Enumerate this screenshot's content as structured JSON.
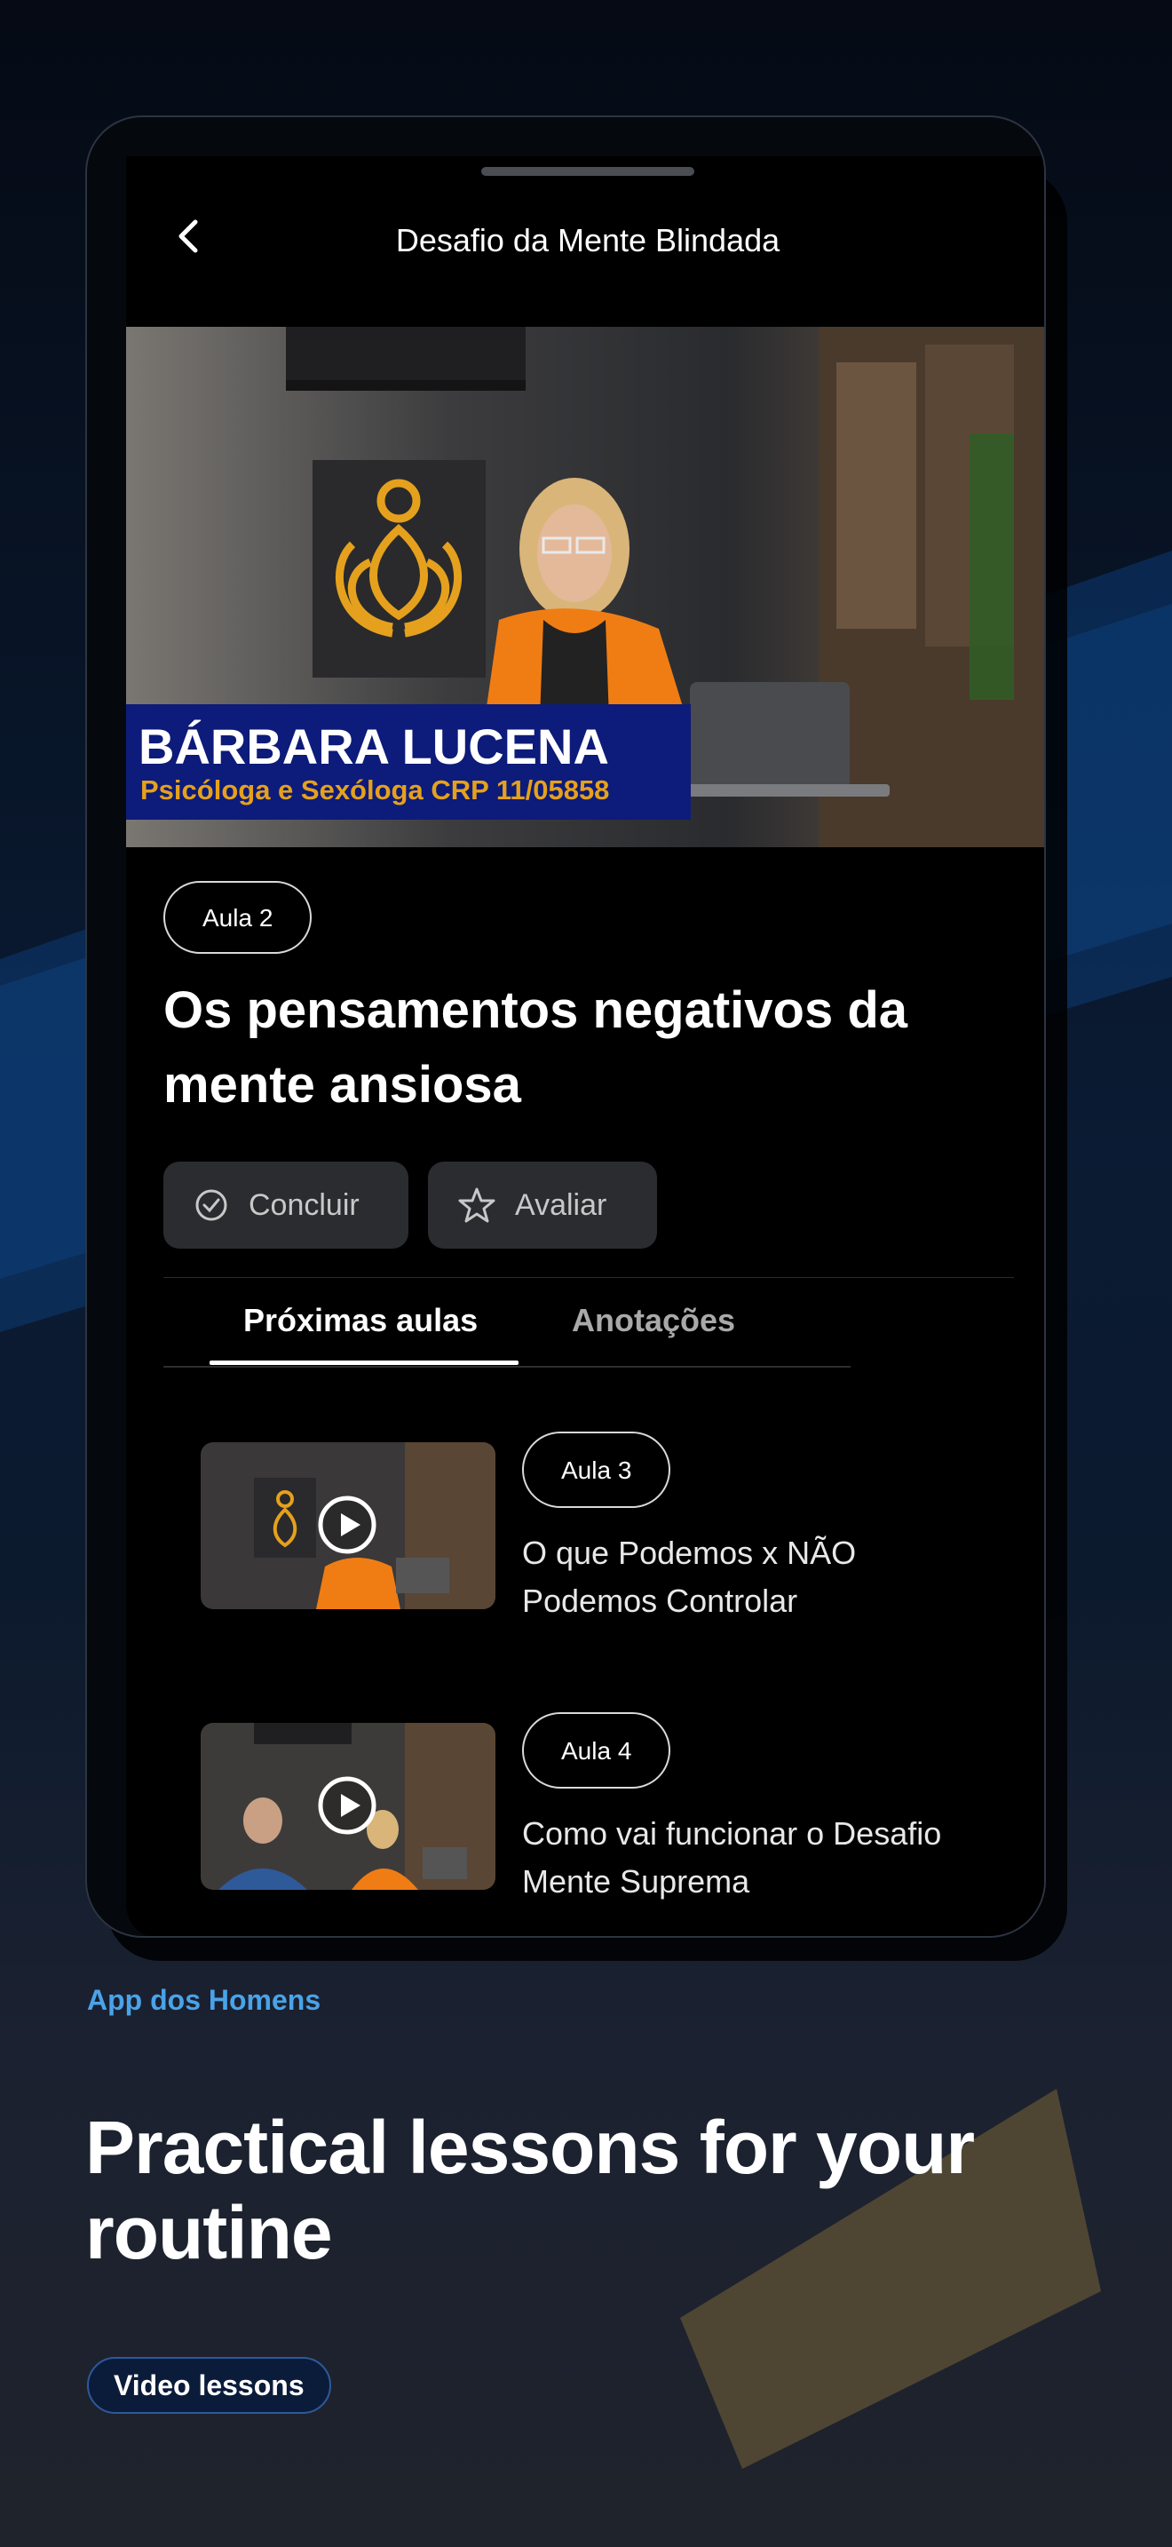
{
  "screen": {
    "nav_title": "Desafio da Mente Blindada",
    "hero": {
      "name": "BÁRBARA LUCENA",
      "role": "Psicóloga e Sexóloga CRP 11/05858"
    },
    "lesson": {
      "badge": "Aula 2",
      "title": "Os pensamentos negativos da mente ansiosa"
    },
    "actions": {
      "complete": "Concluir",
      "rate": "Avaliar"
    },
    "tabs": {
      "next": "Próximas aulas",
      "notes": "Anotações"
    },
    "next_lessons": [
      {
        "badge": "Aula 3",
        "title": "O que Podemos x NÃO Podemos Controlar"
      },
      {
        "badge": "Aula 4",
        "title": "Como vai funcionar o Desafio Mente Suprema"
      }
    ]
  },
  "caption": {
    "app_name": "App dos Homens",
    "headline": "Practical lessons for your routine",
    "pill": "Video lessons"
  },
  "colors": {
    "accent_blue": "#4aa3e8",
    "brand_gold": "#e5a11d",
    "hero_banner": "#0d1b7a"
  }
}
